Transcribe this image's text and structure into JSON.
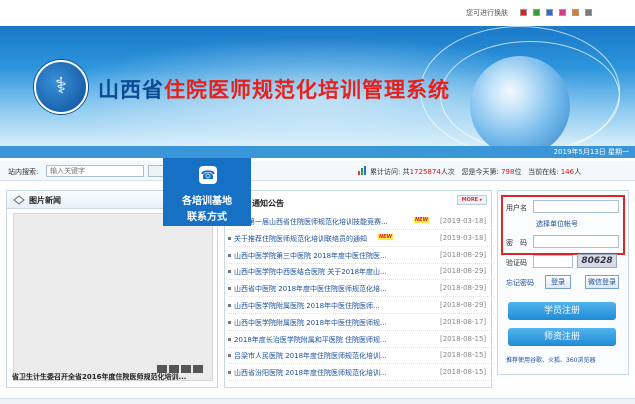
{
  "topbar": {
    "skin_label": "您可进行换肤",
    "skin_colors": [
      "#d42323",
      "#2f9e3a",
      "#2a6fd1",
      "#d33a8a",
      "#e37b1d",
      "#7c7c7c"
    ]
  },
  "header": {
    "title_prefix": "山西省",
    "title_highlight": "住院医师规范化培训管理系统",
    "date": "2019年5月13日 星期一"
  },
  "search": {
    "label": "站内搜索:",
    "placeholder": "输入关键字"
  },
  "stats": {
    "visits_label": "累计访问: 共",
    "visits": "1725874",
    "visits_unit": "人次",
    "today_label": "您是今天第:",
    "today": "798",
    "today_unit": "位",
    "online_label": "当前在线:",
    "online": "146",
    "online_unit": "人"
  },
  "contact": {
    "line1": "各培训基地",
    "line2": "联系方式"
  },
  "photo_news": {
    "title": "图片新闻",
    "caption": "省卫生计生委召开全省2016年度住院医师规范化培训..."
  },
  "notices": {
    "title": "通知公告",
    "more": "MORE",
    "new_badge": "NEW",
    "items": [
      {
        "text": "印发第一届山西省住院医师规范化培训技能竞赛...",
        "date": "[2019-03-18]",
        "new": true
      },
      {
        "text": "关于推荐住院医师规范化培训联络员的通知",
        "date": "[2019-03-18]",
        "new": true
      },
      {
        "text": "山西中医学院第三中医院 2018年度中医住院医...",
        "date": "[2018-08-29]",
        "new": false
      },
      {
        "text": "山西中医学院中西医结合医院 关于2018年度山...",
        "date": "[2018-08-29]",
        "new": false
      },
      {
        "text": "山西省中医院 2018年度中医住院医师规范化培...",
        "date": "[2018-08-29]",
        "new": false
      },
      {
        "text": "山西中医学院附属医院 2018年中医住院医师...",
        "date": "[2018-08-29]",
        "new": false
      },
      {
        "text": "山西中医学院附属医院 2018年中医住院医师规...",
        "date": "[2018-08-17]",
        "new": false
      },
      {
        "text": "2018年度长治医学院附属和平医院 住院医师规...",
        "date": "[2018-08-15]",
        "new": false
      },
      {
        "text": "吕梁市人民医院 2018年度住院医师规范化培训...",
        "date": "[2018-08-15]",
        "new": false
      },
      {
        "text": "山西省汾阳医院 2018年度住院医师规范化培训...",
        "date": "[2018-08-15]",
        "new": false
      }
    ]
  },
  "login": {
    "username_label": "用户名",
    "choose_unit": "选择单位帐号",
    "password_label": "密　码",
    "captcha_label": "验证码",
    "captcha_value": "80628",
    "forgot": "忘记密码",
    "login_button": "登录",
    "wechat_button": "微信登录",
    "student_register": "学员注册",
    "teacher_register": "师资注册",
    "browser_hint": "推荐使用谷歌、火狐、360浏览器"
  }
}
